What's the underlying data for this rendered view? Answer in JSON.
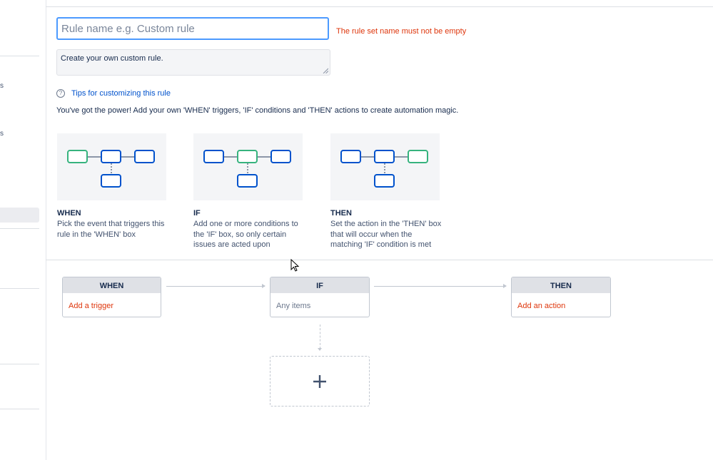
{
  "sidebar": {
    "fragments": [
      "s",
      "s"
    ]
  },
  "form": {
    "name_placeholder": "Rule name e.g. Custom rule",
    "name_value": "",
    "error_text": "The rule set name must not be empty",
    "description": "Create your own custom rule.",
    "tips_link": "Tips for customizing this rule",
    "tips_icon": "question-circle-icon",
    "intro": "You've got the power! Add your own 'WHEN' triggers, 'IF' conditions and 'THEN' actions to create automation magic."
  },
  "cards": [
    {
      "title": "WHEN",
      "desc_lines": [
        "Pick the event that triggers this",
        "rule in the 'WHEN' box"
      ]
    },
    {
      "title": "IF",
      "desc_lines": [
        "Add one or more conditions to",
        "the 'IF' box, so only certain",
        "issues are acted upon"
      ]
    },
    {
      "title": "THEN",
      "desc_lines": [
        "Set the action in the 'THEN' box",
        "that will occur when the",
        "matching 'IF' condition is met"
      ]
    }
  ],
  "flow": {
    "when": {
      "title": "WHEN",
      "action": "Add a trigger"
    },
    "if": {
      "title": "IF",
      "value": "Any items"
    },
    "then": {
      "title": "THEN",
      "action": "Add an action"
    },
    "add_icon": "plus-icon"
  },
  "colors": {
    "accent_blue": "#0052cc",
    "diagram_blue": "#0052cc",
    "diagram_green": "#36b37e",
    "error_red": "#de350b",
    "focus_border": "#4c9aff"
  }
}
